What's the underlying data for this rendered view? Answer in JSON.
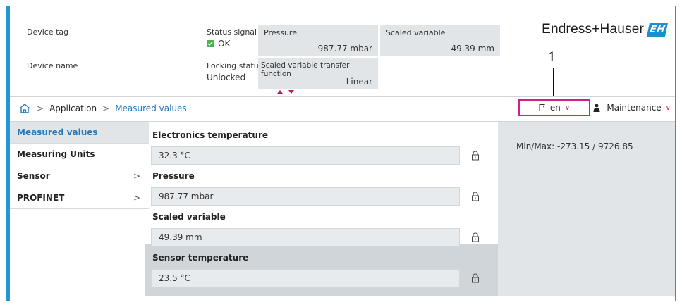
{
  "header": {
    "device_tag_label": "Device tag",
    "device_name_label": "Device name",
    "status_signal_label": "Status signal",
    "status_signal_value": "OK",
    "locking_status_label": "Locking status",
    "locking_status_value": "Unlocked",
    "tiles": [
      {
        "title": "Pressure",
        "value": "987.77 mbar"
      },
      {
        "title": "Scaled variable",
        "value": "49.39 mm"
      },
      {
        "title": "Scaled variable transfer function",
        "value": "Linear"
      }
    ],
    "brand": "Endress+Hauser",
    "brand_mark": "EH",
    "callout_number": "1"
  },
  "nav": {
    "breadcrumb": [
      "Application",
      "Measured values"
    ],
    "language": "en",
    "user_role": "Maintenance"
  },
  "sidebar": {
    "items": [
      {
        "label": "Measured values",
        "has_arrow": false
      },
      {
        "label": "Measuring Units",
        "has_arrow": false
      },
      {
        "label": "Sensor",
        "has_arrow": true,
        "arrow": ">"
      },
      {
        "label": "PROFINET",
        "has_arrow": true,
        "arrow": ">"
      }
    ]
  },
  "fields": [
    {
      "label": "Electronics temperature",
      "value": "32.3 °C"
    },
    {
      "label": "Pressure",
      "value": "987.77 mbar"
    },
    {
      "label": "Scaled variable",
      "value": "49.39 mm"
    },
    {
      "label": "Sensor temperature",
      "value": "23.5 °C"
    }
  ],
  "info_panel": {
    "minmax": "Min/Max: -273.15 / 9726.85"
  },
  "colors": {
    "accent_blue": "#2396d6",
    "link_blue": "#2578b8",
    "highlight_magenta": "#d31f8a",
    "status_ok_green": "#4caf50",
    "panel_grey": "#e1e5e8"
  }
}
